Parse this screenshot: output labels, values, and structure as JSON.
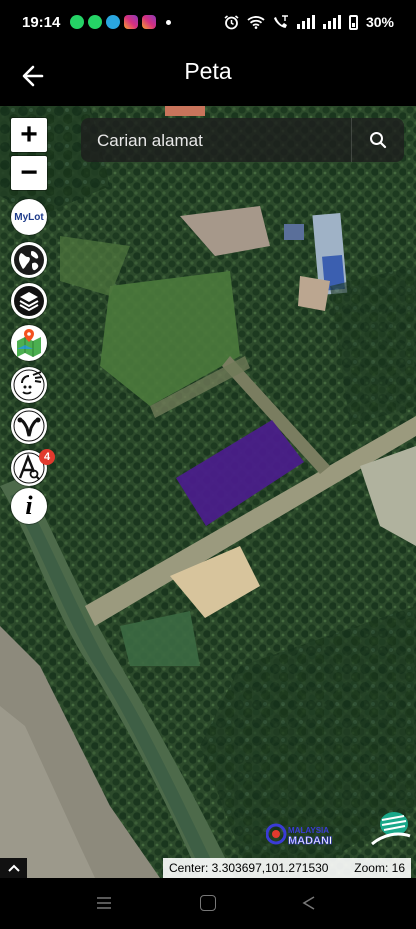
{
  "status_bar": {
    "time": "19:14",
    "battery": "30%",
    "notification_icons": [
      "whatsapp-icon",
      "whatsapp-business-icon",
      "telegram-icon",
      "instagram-icon",
      "instagram-icon"
    ],
    "colors": {
      "whatsapp": "#25d366",
      "telegram": "#2aa6df",
      "instagram": "#d6307f"
    }
  },
  "header": {
    "title": "Peta"
  },
  "search": {
    "placeholder": "Carian alamat"
  },
  "map_controls": {
    "zoom_in": "+",
    "zoom_out": "−",
    "mylot_label": "MyLot",
    "layer_badge_count": "4",
    "info_label": "i"
  },
  "map_footer": {
    "center": "Center: 3.303697,101.271530",
    "zoom": "Zoom: 16",
    "logo_text": "MALAYSIA MADANI"
  },
  "colors": {
    "parcel_highlight": "#4a1d8a",
    "search_bg": "#1e1e1e"
  }
}
